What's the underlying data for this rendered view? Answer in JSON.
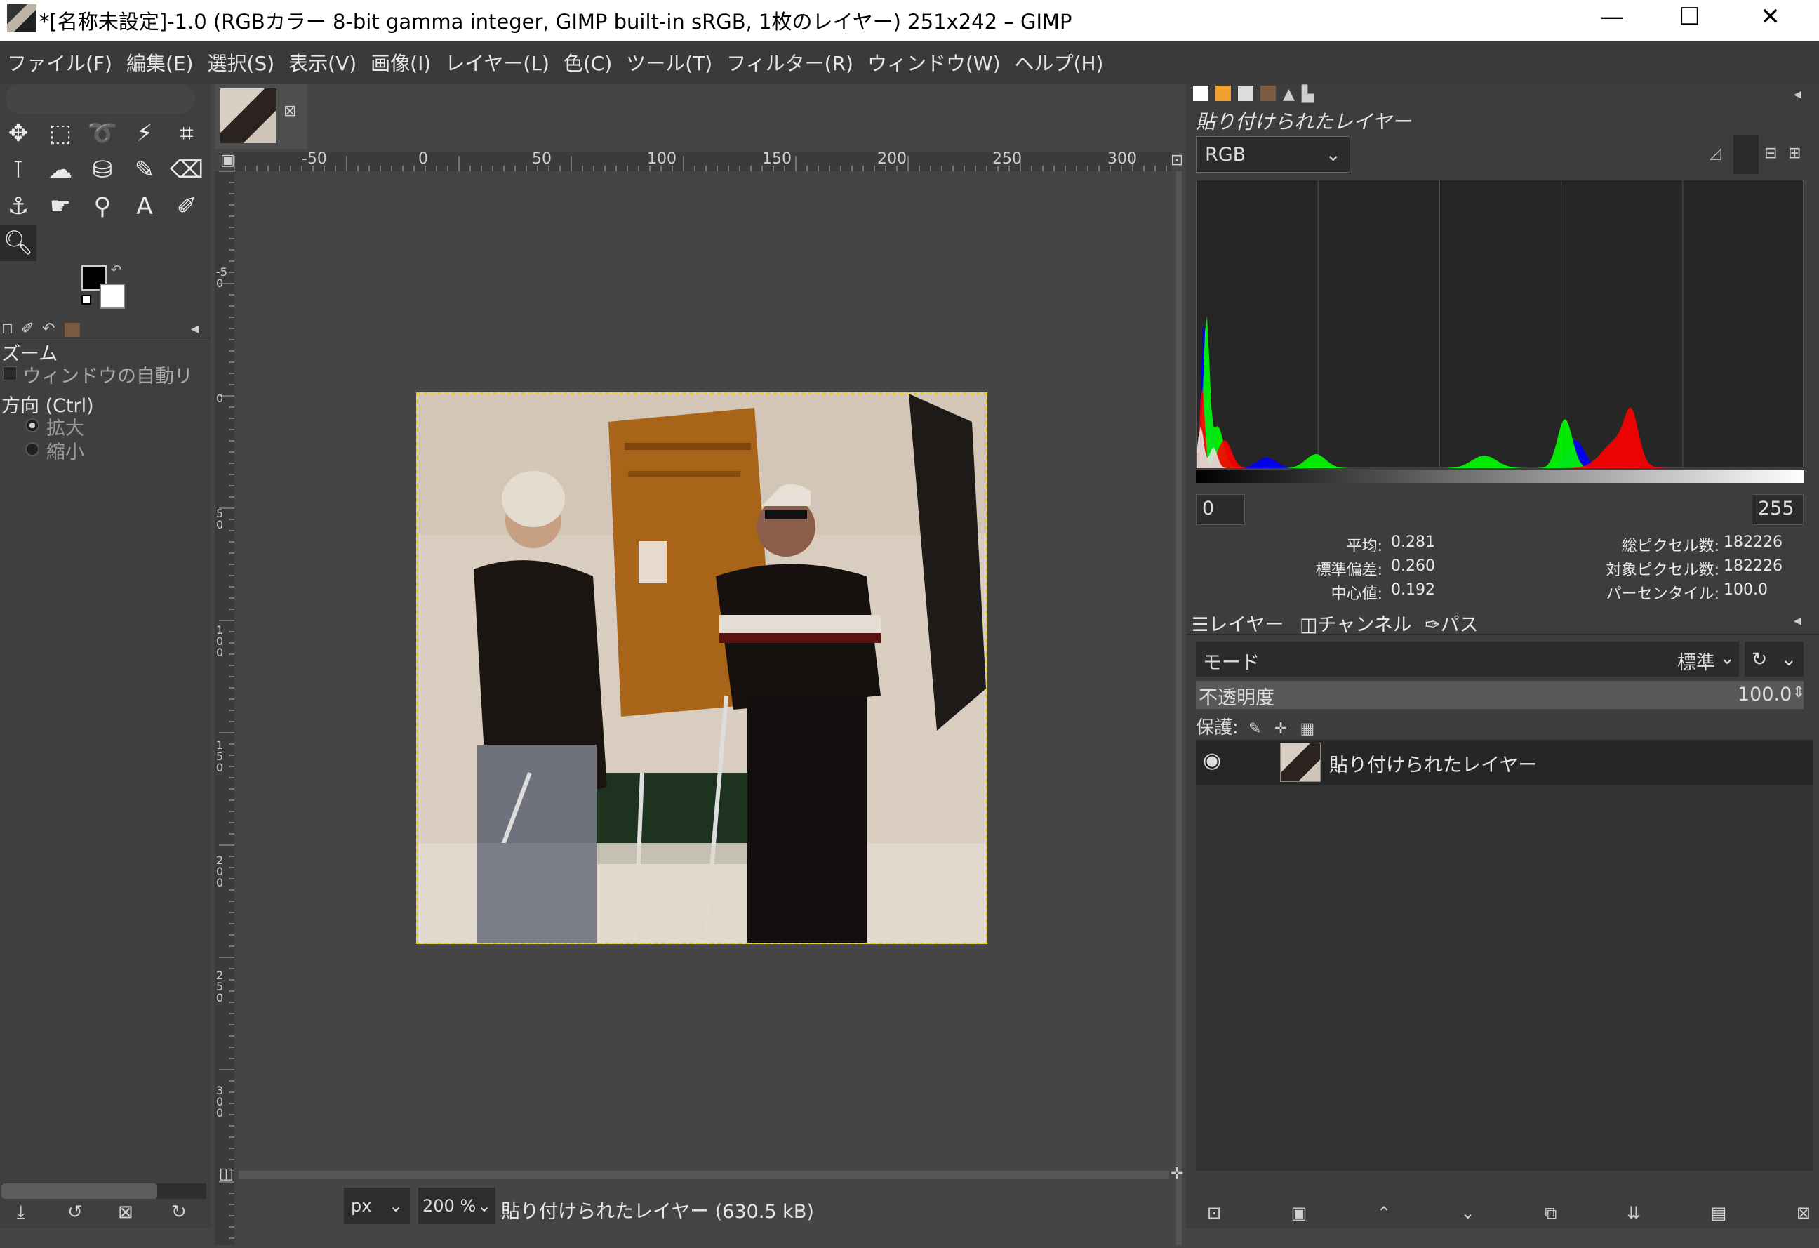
{
  "window": {
    "title": "*[名称未設定]-1.0 (RGBカラー 8-bit gamma integer, GIMP built-in sRGB, 1枚のレイヤー) 251x242 – GIMP",
    "controls": {
      "minimize": "—",
      "maximize": "☐",
      "close": "✕"
    }
  },
  "menu": [
    "ファイル(F)",
    "編集(E)",
    "選択(S)",
    "表示(V)",
    "画像(I)",
    "レイヤー(L)",
    "色(C)",
    "ツール(T)",
    "フィルター(R)",
    "ウィンドウ(W)",
    "ヘルプ(H)"
  ],
  "tool_options": {
    "title": "ズーム",
    "auto_resize_label": "ウィンドウの自動リ",
    "direction_label": "方向 (Ctrl)",
    "options": [
      "拡大",
      "縮小"
    ]
  },
  "ruler": {
    "h_labels": [
      "-50",
      "0",
      "50",
      "100",
      "150",
      "200",
      "250",
      "300"
    ],
    "v_labels": [
      "-50",
      "0",
      "50",
      "100",
      "150",
      "200",
      "250",
      "300"
    ]
  },
  "statusbar": {
    "unit": "px",
    "zoom": "200 %",
    "info": "貼り付けられたレイヤー (630.5 kB)"
  },
  "histogram": {
    "layer_title": "貼り付けられたレイヤー",
    "channel": "RGB",
    "range_min": "0",
    "range_max": "255",
    "stats_left": [
      {
        "label": "平均:",
        "value": "0.281"
      },
      {
        "label": "標準偏差:",
        "value": "0.260"
      },
      {
        "label": "中心値:",
        "value": "0.192"
      }
    ],
    "stats_right": [
      {
        "label": "総ピクセル数:",
        "value": "182226"
      },
      {
        "label": "対象ピクセル数:",
        "value": "182226"
      },
      {
        "label": "パーセンタイル:",
        "value": "100.0"
      }
    ]
  },
  "layers": {
    "tabs": [
      "レイヤー",
      "チャンネル",
      "パス"
    ],
    "mode_label": "モード",
    "mode_value": "標準",
    "opacity_label": "不透明度",
    "opacity_value": "100.0",
    "lock_label": "保護:",
    "items": [
      {
        "name": "貼り付けられたレイヤー"
      }
    ]
  },
  "colors": {
    "accent_yellow": "#e8d000",
    "panel_bg": "#3d3d3d"
  }
}
